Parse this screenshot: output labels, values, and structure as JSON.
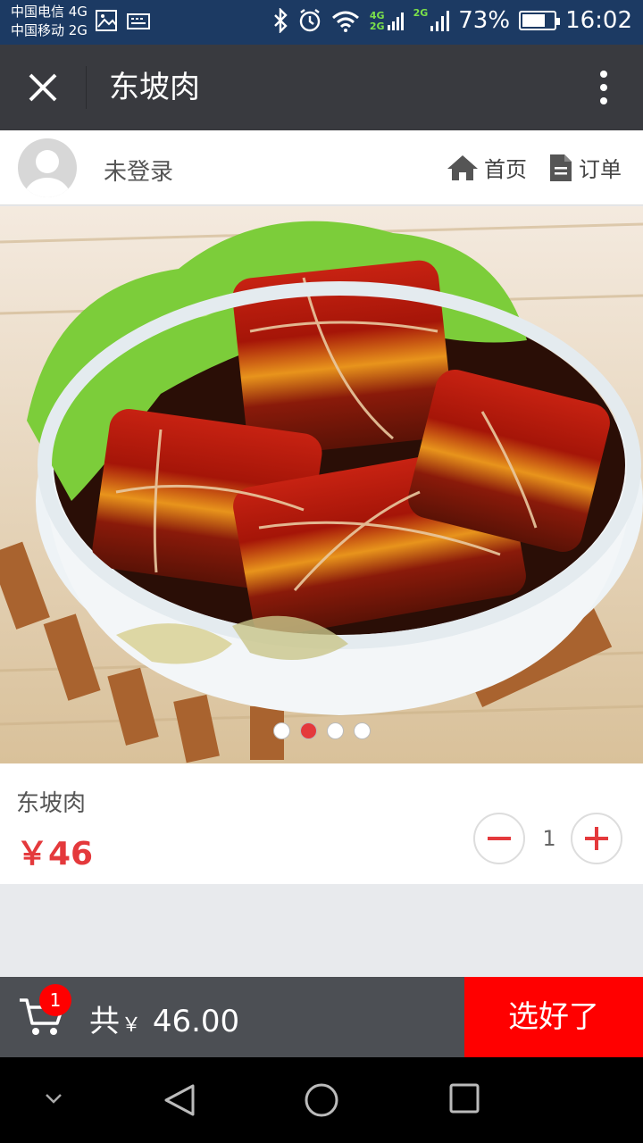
{
  "status_bar": {
    "carrier_1": "中国电信 4G",
    "carrier_2": "中国移动 2G",
    "net_4g": "4G",
    "net_2g_a": "2G",
    "net_2g_b": "2G",
    "battery": "73%",
    "battery_level": 0.73,
    "time": "16:02"
  },
  "app_bar": {
    "title": "东坡肉"
  },
  "user_row": {
    "username": "未登录",
    "home_label": "首页",
    "orders_label": "订单"
  },
  "carousel": {
    "slide_count": 4,
    "active_index": 1
  },
  "product": {
    "name": "东坡肉",
    "price": "￥46",
    "quantity": "1"
  },
  "cart_bar": {
    "badge_count": "1",
    "total_prefix": "共",
    "currency": "￥",
    "total_amount": " 46.00",
    "confirm_label": "选好了"
  },
  "colors": {
    "accent_red": "#e4393c",
    "confirm_red": "#ff0000",
    "app_bar": "#393a3f"
  }
}
